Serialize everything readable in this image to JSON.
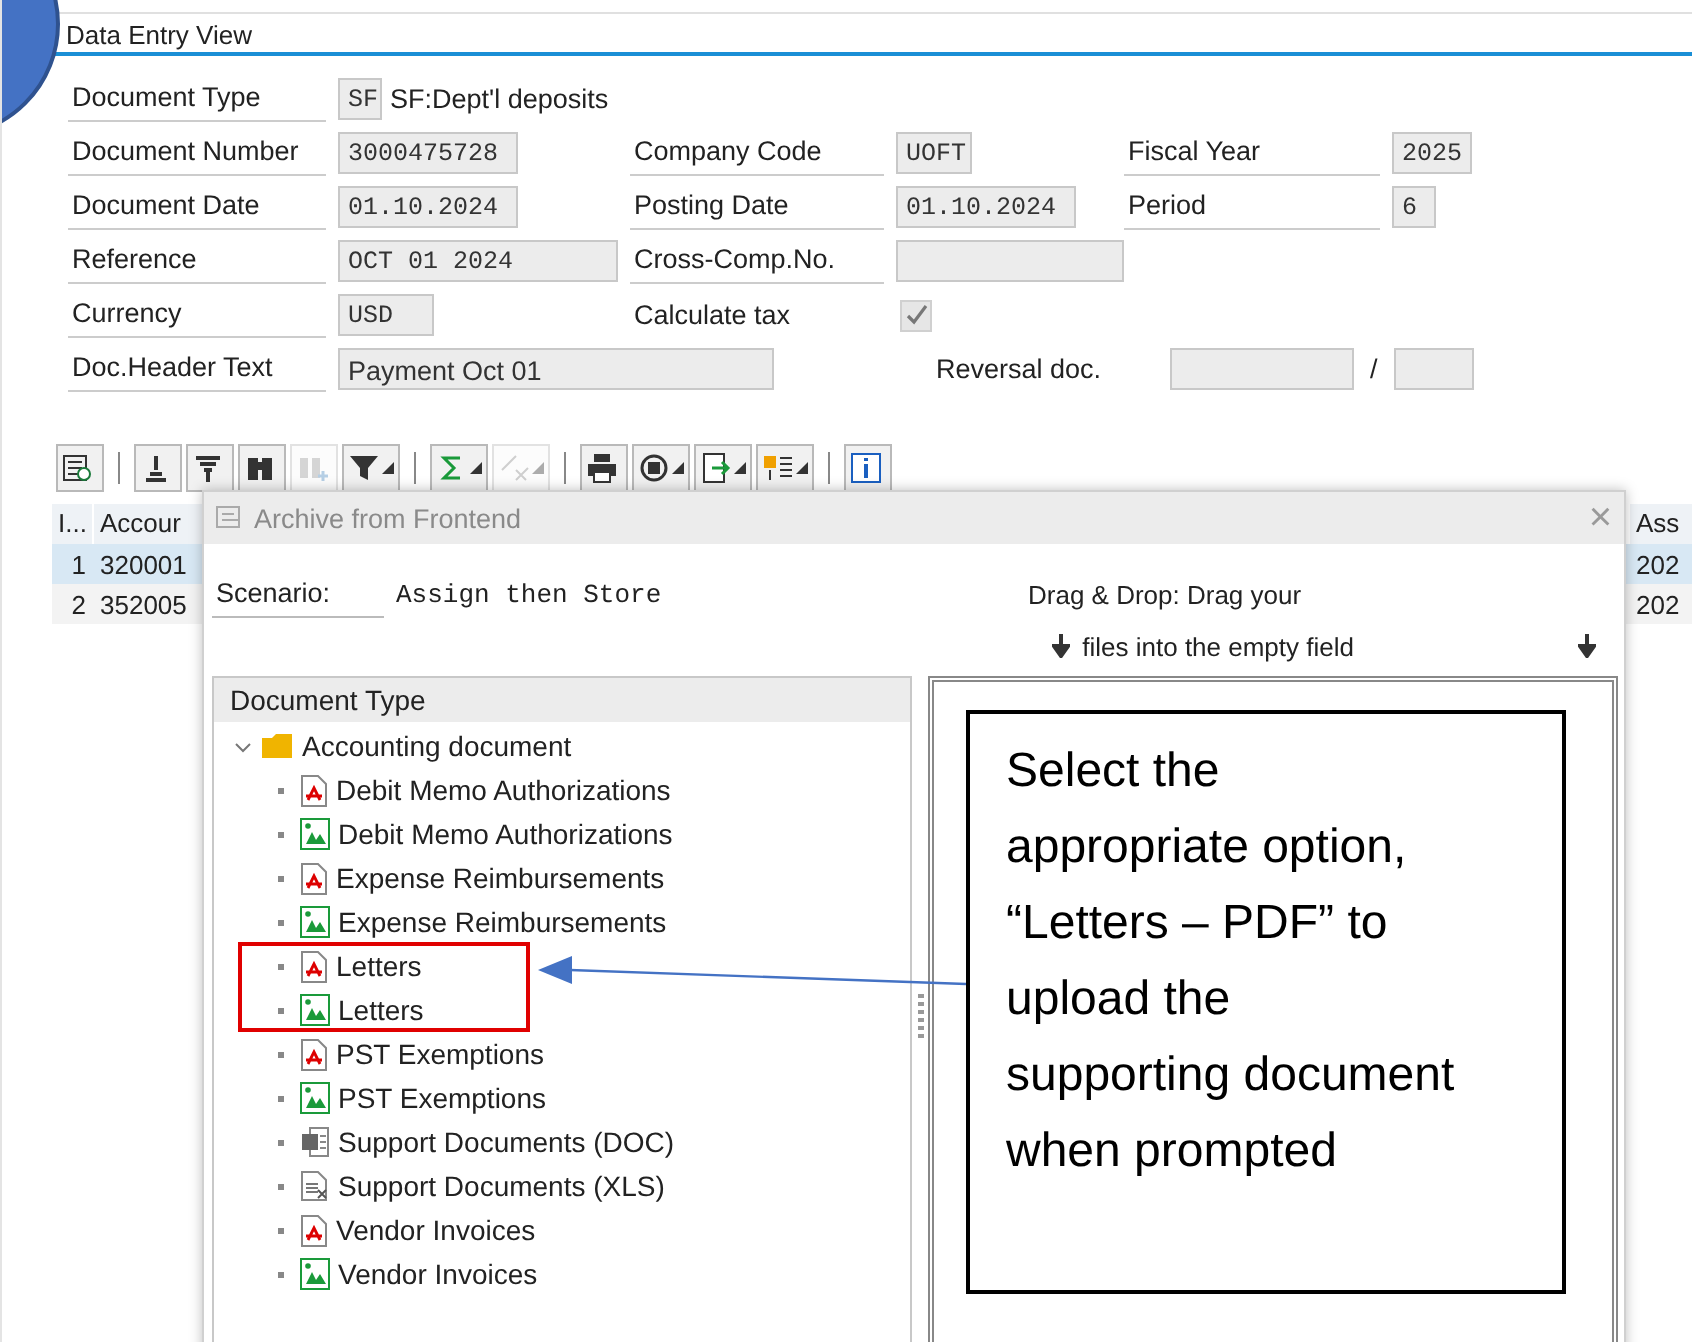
{
  "header": {
    "title": "Data Entry View"
  },
  "form": {
    "document_type": {
      "label": "Document Type",
      "code": "SF",
      "text": "SF:Dept'l deposits"
    },
    "rows": [
      [
        {
          "label": "Document Number",
          "value": "3000475728"
        },
        {
          "label": "Company Code",
          "value": "UOFT"
        },
        {
          "label": "Fiscal Year",
          "value": "2025"
        }
      ],
      [
        {
          "label": "Document Date",
          "value": "01.10.2024"
        },
        {
          "label": "Posting Date",
          "value": "01.10.2024"
        },
        {
          "label": "Period",
          "value": "6"
        }
      ],
      [
        {
          "label": "Reference",
          "value": "OCT 01 2024"
        },
        {
          "label": "Cross-Comp.No."
        }
      ]
    ],
    "currency": {
      "label": "Currency",
      "value": "USD"
    },
    "calculate_tax": {
      "label": "Calculate tax",
      "checked": true
    },
    "header_text": {
      "label": "Doc.Header Text",
      "value": "Payment Oct 01"
    },
    "reversal": {
      "label": "Reversal doc.",
      "separator": "/"
    }
  },
  "toolbar": [
    {
      "kind": "details",
      "menu": false,
      "disabled": false
    },
    {
      "kind": "separator"
    },
    {
      "kind": "sort-asc",
      "menu": false,
      "disabled": false
    },
    {
      "kind": "sort-desc",
      "menu": false,
      "disabled": false
    },
    {
      "kind": "find",
      "menu": false,
      "disabled": false
    },
    {
      "kind": "find-next",
      "menu": false,
      "disabled": true
    },
    {
      "kind": "filter",
      "menu": true,
      "disabled": false
    },
    {
      "kind": "separator"
    },
    {
      "kind": "sum",
      "menu": true,
      "disabled": false
    },
    {
      "kind": "subtotal",
      "menu": true,
      "disabled": true
    },
    {
      "kind": "separator"
    },
    {
      "kind": "print",
      "menu": false,
      "disabled": false
    },
    {
      "kind": "views",
      "menu": true,
      "disabled": false
    },
    {
      "kind": "export",
      "menu": true,
      "disabled": false
    },
    {
      "kind": "layout",
      "menu": true,
      "disabled": false
    },
    {
      "kind": "separator"
    },
    {
      "kind": "info",
      "menu": false,
      "disabled": false
    }
  ],
  "table": {
    "columns": [
      "I...",
      "Accour",
      "Ass"
    ],
    "rows": [
      {
        "selected": true,
        "cells": [
          "1",
          "320001",
          "202"
        ]
      },
      {
        "selected": false,
        "cells": [
          "2",
          "352005",
          "202"
        ]
      }
    ]
  },
  "dialog": {
    "title": "Archive from Frontend",
    "close": "×",
    "scenario": {
      "label": "Scenario:",
      "value": "Assign then Store"
    },
    "drag_hint": {
      "line_1": "Drag & Drop: Drag your",
      "line_2": "files into the empty field"
    },
    "tree": {
      "heading": "Document Type",
      "items": [
        {
          "label": "Accounting document",
          "kind": "folder",
          "expanded": true,
          "children": [
            {
              "label": "Debit Memo Authorizations",
              "kind": "pdf"
            },
            {
              "label": "Debit Memo Authorizations",
              "kind": "image"
            },
            {
              "label": "Expense Reimbursements",
              "kind": "pdf"
            },
            {
              "label": "Expense Reimbursements",
              "kind": "image"
            },
            {
              "label": "Letters",
              "kind": "pdf"
            },
            {
              "label": "Letters",
              "kind": "image"
            },
            {
              "label": "PST Exemptions",
              "kind": "pdf"
            },
            {
              "label": "PST Exemptions",
              "kind": "image"
            },
            {
              "label": "Support Documents (DOC)",
              "kind": "doc"
            },
            {
              "label": "Support Documents (XLS)",
              "kind": "xls"
            },
            {
              "label": "Vendor Invoices",
              "kind": "pdf"
            },
            {
              "label": "Vendor Invoices",
              "kind": "image"
            }
          ]
        }
      ]
    }
  },
  "callout": {
    "text": "Select the appropriate option, “Letters – PDF” to upload the supporting document when prompted"
  }
}
